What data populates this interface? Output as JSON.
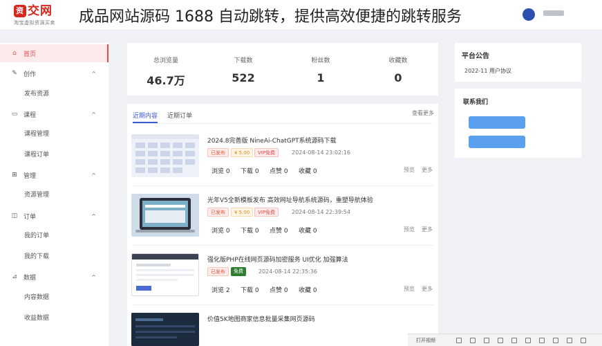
{
  "header": {
    "logo_mark": "资",
    "logo_text": "交网",
    "logo_sub": "淘宝虚拟资源买卖",
    "banner": "成品网站源码 1688 自动跳转，提供高效便捷的跳转服务"
  },
  "sidebar": {
    "items": [
      {
        "label": "首页",
        "icon": "home-icon",
        "glyph": "⌂",
        "active": true
      },
      {
        "label": "创作",
        "icon": "edit-icon",
        "glyph": "✎",
        "caret": "^"
      },
      {
        "label": "课程",
        "icon": "video-icon",
        "glyph": "▭",
        "caret": "^"
      },
      {
        "label": "管理",
        "icon": "grid-icon",
        "glyph": "⊞",
        "caret": "^"
      },
      {
        "label": "订单",
        "icon": "order-icon",
        "glyph": "◫",
        "caret": "^"
      },
      {
        "label": "数据",
        "icon": "chart-icon",
        "glyph": "⊿",
        "caret": "^"
      }
    ],
    "subitems": {
      "publish": "发布资源",
      "course_manage": "课程管理",
      "course_order": "课程订单",
      "resource_manage": "资源管理",
      "my_orders": "我的订单",
      "my_downloads": "我的下载",
      "content_data": "内容数据",
      "revenue_data": "收益数据"
    }
  },
  "stats": [
    {
      "label": "总浏览量",
      "value": "46.7万"
    },
    {
      "label": "下载数",
      "value": "522"
    },
    {
      "label": "粉丝数",
      "value": "1"
    },
    {
      "label": "收藏数",
      "value": "0"
    }
  ],
  "content": {
    "tabs": [
      "近期内容",
      "近期订单"
    ],
    "view_all": "查看更多",
    "items": [
      {
        "title": "2024.8完善版 NineAi-ChatGPT系统源码下载",
        "status": "已发布",
        "price": "¥ 5.00",
        "tag": "VIP免费",
        "date": "2024-08-14 23:02:16",
        "views": "浏览 0",
        "downloads": "下载 0",
        "likes": "点赞 0",
        "favs": "收藏 0",
        "preview": "预览",
        "more": "更多"
      },
      {
        "title": "光年V5全新模板发布 高效网址导航系统源码，重塑导航体验",
        "status": "已发布",
        "price": "¥ 5.00",
        "tag": "VIP免费",
        "date": "2024-08-14 22:39:54",
        "views": "浏览 0",
        "downloads": "下载 0",
        "likes": "点赞 0",
        "favs": "收藏 0",
        "preview": "预览",
        "more": "更多"
      },
      {
        "title": "强化版PHP在线网页源码加密服务 UI优化 加强算法",
        "status": "已发布",
        "tag": "免费",
        "date": "2024-08-14 22:35:36",
        "views": "浏览 2",
        "downloads": "下载 0",
        "likes": "点赞 0",
        "favs": "收藏 0",
        "preview": "预览",
        "more": "更多"
      },
      {
        "title": "价值5K地图商家信息批量采集网页源码"
      }
    ]
  },
  "notice": {
    "title": "平台公告",
    "line": "2022-11  用户协议"
  },
  "contact": {
    "title": "联系我们"
  },
  "taskbar": {
    "label": "打开视频"
  }
}
